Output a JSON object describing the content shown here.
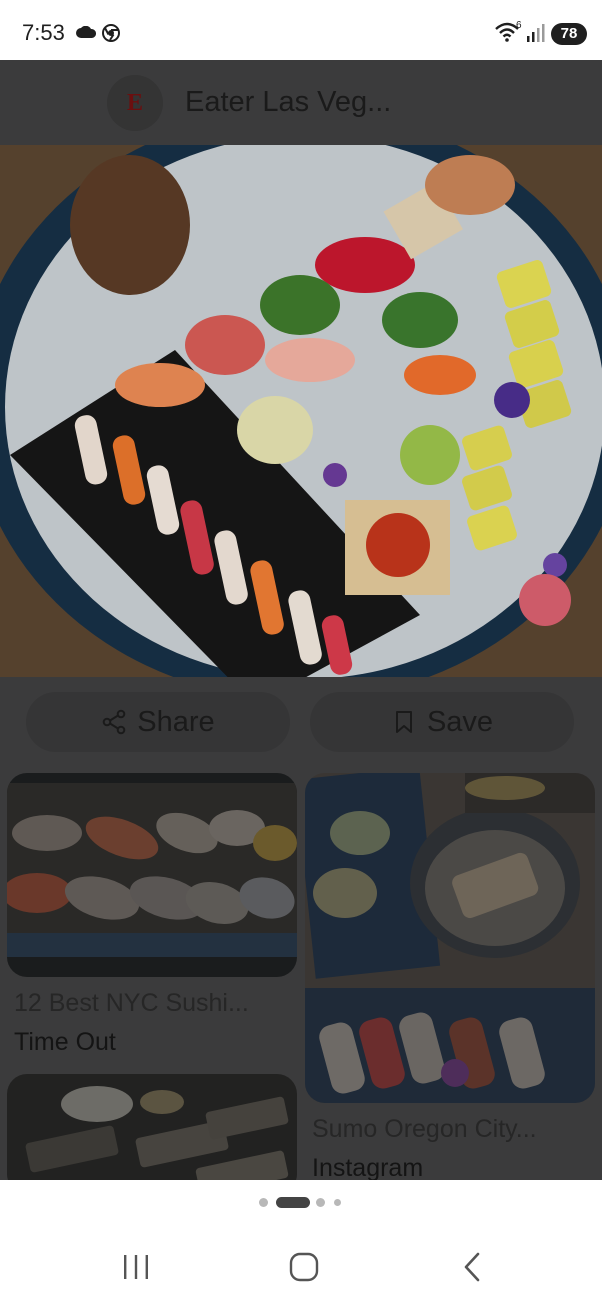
{
  "status_bar": {
    "time": "7:53",
    "wifi_superscript": "6",
    "battery_level": "78",
    "icons": [
      "cloud-icon",
      "chrome-icon",
      "wifi-icon",
      "signal-icon",
      "battery-icon"
    ]
  },
  "header": {
    "site_logo_letter": "E",
    "site_title": "Eater Las Veg..."
  },
  "actions": {
    "share_label": "Share",
    "save_label": "Save"
  },
  "related": [
    {
      "title": "12 Best NYC Sushi...",
      "source": "Time Out"
    },
    {
      "title": "Sumo Oregon City...",
      "source": "Instagram"
    }
  ],
  "pager": {
    "count": 4,
    "active_index": 1
  },
  "nav": {
    "icons": [
      "recent-apps-icon",
      "home-icon",
      "back-icon"
    ]
  },
  "colors": {
    "scrim": "#3b3b3c",
    "logo_red": "#6b0f0f"
  }
}
